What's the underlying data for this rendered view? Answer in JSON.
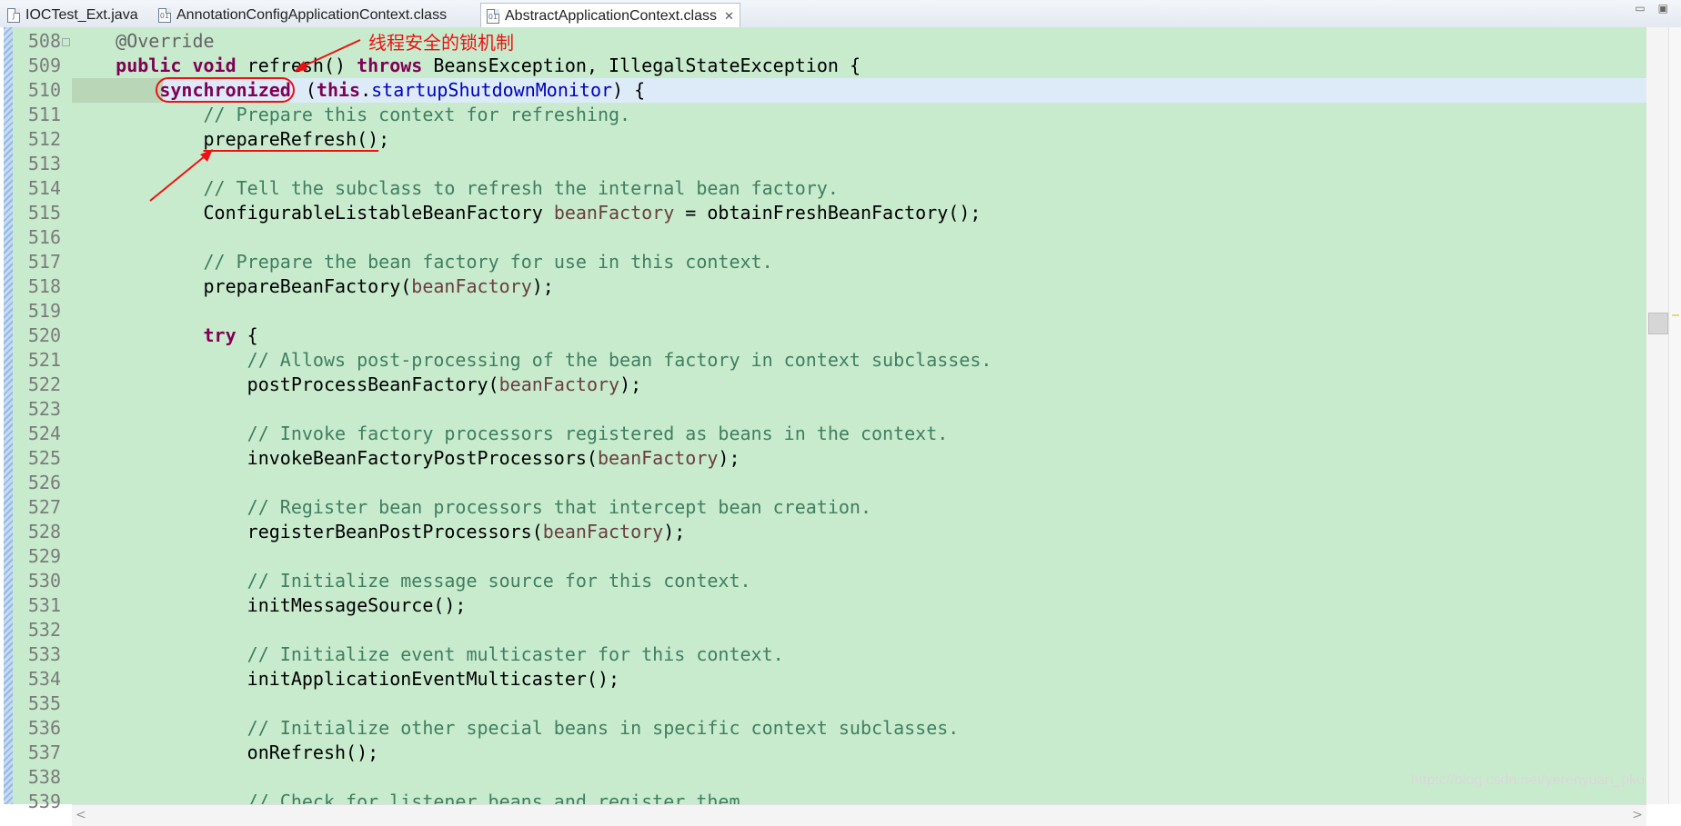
{
  "tabs": [
    {
      "label": "IOCTest_Ext.java",
      "icon": "java-file-icon",
      "icon_glyph": "J",
      "active": false
    },
    {
      "label": "AnnotationConfigApplicationContext.class",
      "icon": "class-file-icon",
      "icon_glyph": "01",
      "active": false
    },
    {
      "label": "AbstractApplicationContext.class",
      "icon": "class-file-icon",
      "icon_glyph": "01",
      "active": true,
      "close": "✕"
    }
  ],
  "window_controls": {
    "minimize": "▭",
    "maximize": "▣"
  },
  "editor": {
    "current_line": 510,
    "lines": [
      {
        "num": "508",
        "fold": true,
        "segs": [
          [
            "    ",
            ""
          ],
          [
            "@Override",
            "an"
          ]
        ]
      },
      {
        "num": "509",
        "segs": [
          [
            "    ",
            ""
          ],
          [
            "public",
            "kw"
          ],
          [
            " ",
            ""
          ],
          [
            "void",
            "kw"
          ],
          [
            " refresh() ",
            ""
          ],
          [
            "throws",
            "kw"
          ],
          [
            " BeansException, IllegalStateException {",
            ""
          ]
        ]
      },
      {
        "num": "510",
        "segs": [
          [
            "        ",
            ""
          ],
          [
            "synchronized",
            "kw hl-ann"
          ],
          [
            " (",
            ""
          ],
          [
            "this",
            "kw"
          ],
          [
            ".",
            ""
          ],
          [
            "startupShutdownMonitor",
            "fld"
          ],
          [
            ") {",
            ""
          ]
        ]
      },
      {
        "num": "511",
        "segs": [
          [
            "            ",
            ""
          ],
          [
            "// Prepare this context for refreshing.",
            "cm"
          ]
        ]
      },
      {
        "num": "512",
        "segs": [
          [
            "            ",
            ""
          ],
          [
            "prepareRefresh()",
            "ul"
          ],
          [
            ";",
            ""
          ]
        ]
      },
      {
        "num": "513",
        "segs": []
      },
      {
        "num": "514",
        "segs": [
          [
            "            ",
            ""
          ],
          [
            "// Tell the subclass to refresh the internal bean factory.",
            "cm"
          ]
        ]
      },
      {
        "num": "515",
        "segs": [
          [
            "            ConfigurableListableBeanFactory ",
            ""
          ],
          [
            "beanFactory",
            "var"
          ],
          [
            " = obtainFreshBeanFactory();",
            ""
          ]
        ]
      },
      {
        "num": "516",
        "segs": []
      },
      {
        "num": "517",
        "segs": [
          [
            "            ",
            ""
          ],
          [
            "// Prepare the bean factory for use in this context.",
            "cm"
          ]
        ]
      },
      {
        "num": "518",
        "segs": [
          [
            "            prepareBeanFactory(",
            ""
          ],
          [
            "beanFactory",
            "var"
          ],
          [
            ");",
            ""
          ]
        ]
      },
      {
        "num": "519",
        "segs": []
      },
      {
        "num": "520",
        "segs": [
          [
            "            ",
            ""
          ],
          [
            "try",
            "kw"
          ],
          [
            " {",
            ""
          ]
        ]
      },
      {
        "num": "521",
        "segs": [
          [
            "                ",
            ""
          ],
          [
            "// Allows post-processing of the bean factory in context subclasses.",
            "cm"
          ]
        ]
      },
      {
        "num": "522",
        "segs": [
          [
            "                postProcessBeanFactory(",
            ""
          ],
          [
            "beanFactory",
            "var"
          ],
          [
            ");",
            ""
          ]
        ]
      },
      {
        "num": "523",
        "segs": []
      },
      {
        "num": "524",
        "segs": [
          [
            "                ",
            ""
          ],
          [
            "// Invoke factory processors registered as beans in the context.",
            "cm"
          ]
        ]
      },
      {
        "num": "525",
        "segs": [
          [
            "                invokeBeanFactoryPostProcessors(",
            ""
          ],
          [
            "beanFactory",
            "var"
          ],
          [
            ");",
            ""
          ]
        ]
      },
      {
        "num": "526",
        "segs": []
      },
      {
        "num": "527",
        "segs": [
          [
            "                ",
            ""
          ],
          [
            "// Register bean processors that intercept bean creation.",
            "cm"
          ]
        ]
      },
      {
        "num": "528",
        "segs": [
          [
            "                registerBeanPostProcessors(",
            ""
          ],
          [
            "beanFactory",
            "var"
          ],
          [
            ");",
            ""
          ]
        ]
      },
      {
        "num": "529",
        "segs": []
      },
      {
        "num": "530",
        "segs": [
          [
            "                ",
            ""
          ],
          [
            "// Initialize message source for this context.",
            "cm"
          ]
        ]
      },
      {
        "num": "531",
        "segs": [
          [
            "                initMessageSource();",
            ""
          ]
        ]
      },
      {
        "num": "532",
        "segs": []
      },
      {
        "num": "533",
        "segs": [
          [
            "                ",
            ""
          ],
          [
            "// Initialize event multicaster for this context.",
            "cm"
          ]
        ]
      },
      {
        "num": "534",
        "segs": [
          [
            "                initApplicationEventMulticaster();",
            ""
          ]
        ]
      },
      {
        "num": "535",
        "segs": []
      },
      {
        "num": "536",
        "segs": [
          [
            "                ",
            ""
          ],
          [
            "// Initialize other special beans in specific context subclasses.",
            "cm"
          ]
        ]
      },
      {
        "num": "537",
        "segs": [
          [
            "                onRefresh();",
            ""
          ]
        ]
      },
      {
        "num": "538",
        "segs": []
      },
      {
        "num": "539",
        "segs": [
          [
            "                ",
            ""
          ],
          [
            "// Check for listener beans and register them.",
            "cm"
          ]
        ]
      }
    ]
  },
  "annotation": {
    "callout_text": "线程安全的锁机制",
    "color": "#ee1111"
  },
  "scrollbar": {
    "left_arrow": "<",
    "right_arrow": ">"
  },
  "watermark": "https://blog.csdn.net/yerenyuan_pku",
  "colors": {
    "editor_bg": "#c8ebce",
    "keyword": "#7f0055",
    "comment": "#3f7f5f",
    "field": "#0000c0",
    "variable": "#6a3e3e",
    "annotation_mark": "#ee1111"
  }
}
